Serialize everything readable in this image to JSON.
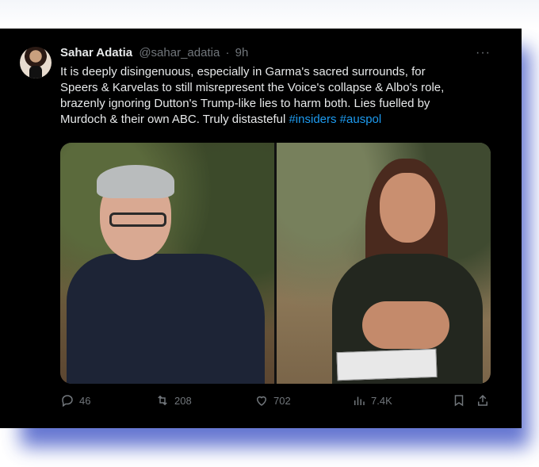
{
  "tweet": {
    "author_name": "Sahar Adatia",
    "author_handle": "@sahar_adatia",
    "separator": "·",
    "time_ago": "9h",
    "more_label": "···",
    "text_line1": "It is deeply disingenuous, especially in Garma's sacred surrounds, for",
    "text_line2": "Speers & Karvelas to still misrepresent the Voice's collapse & Albo's role,",
    "text_line3": "brazenly ignoring Dutton's Trump-like lies to harm both. Lies fuelled by",
    "text_line4_prefix": "Murdoch & their own ABC. Truly distasteful",
    "hashtags": [
      "#insiders",
      "#auspol"
    ]
  },
  "actions": {
    "replies": "46",
    "retweets": "208",
    "likes": "702",
    "views": "7.4K"
  },
  "icons": {
    "reply": "reply-icon",
    "retweet": "retweet-icon",
    "like": "heart-icon",
    "views": "views-icon",
    "bookmark": "bookmark-icon",
    "share": "share-icon"
  },
  "colors": {
    "background": "#000000",
    "text": "#e7e9ea",
    "muted": "#71767b",
    "link": "#1d9bf0",
    "shadow": "#4b5fc9"
  }
}
